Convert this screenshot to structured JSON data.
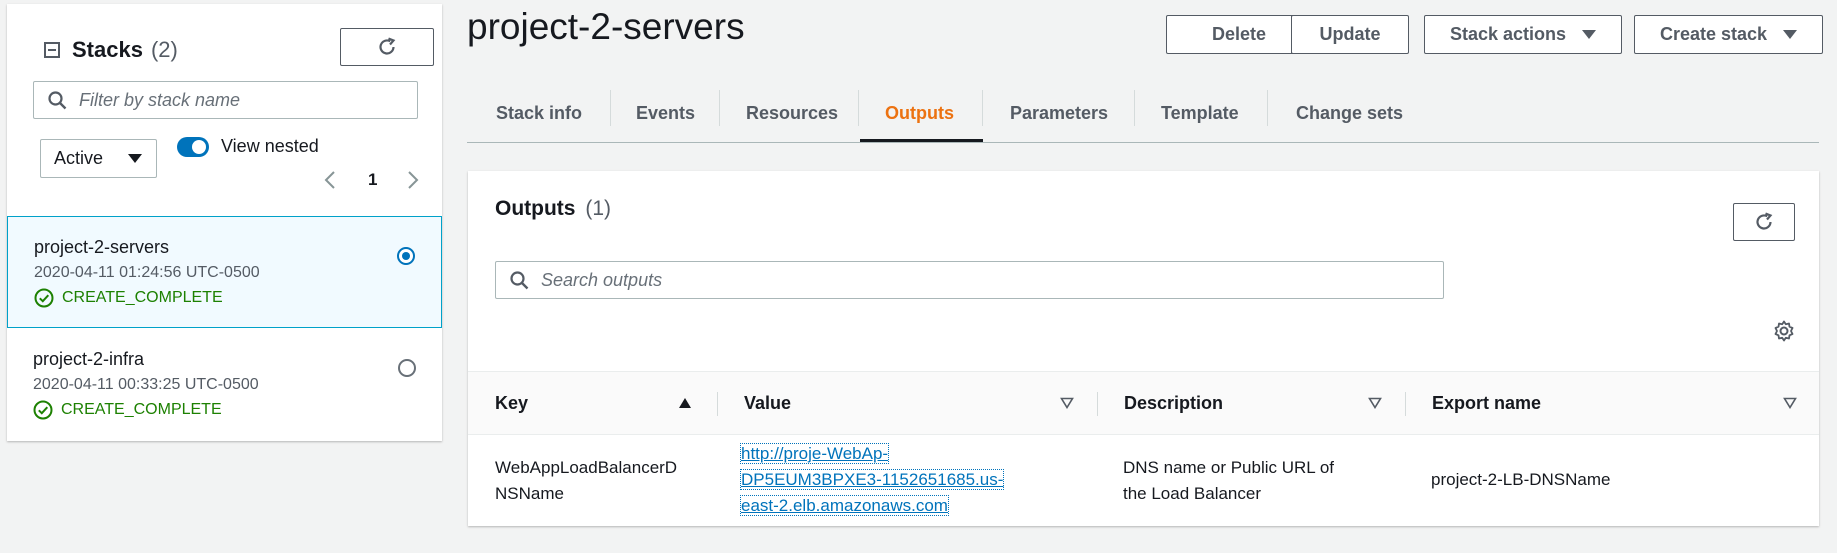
{
  "sidebar": {
    "title": "Stacks",
    "count": "(2)",
    "filter_placeholder": "Filter by stack name",
    "status_filter": "Active",
    "view_nested_label": "View nested",
    "page": "1",
    "stacks": [
      {
        "name": "project-2-servers",
        "date": "2020-04-11 01:24:56 UTC-0500",
        "status": "CREATE_COMPLETE"
      },
      {
        "name": "project-2-infra",
        "date": "2020-04-11 00:33:25 UTC-0500",
        "status": "CREATE_COMPLETE"
      }
    ]
  },
  "header": {
    "title": "project-2-servers",
    "buttons": {
      "delete": "Delete",
      "update": "Update",
      "stack_actions": "Stack actions",
      "create_stack": "Create stack"
    }
  },
  "tabs": [
    "Stack info",
    "Events",
    "Resources",
    "Outputs",
    "Parameters",
    "Template",
    "Change sets"
  ],
  "outputs": {
    "title": "Outputs",
    "count": "(1)",
    "search_placeholder": "Search outputs",
    "columns": [
      "Key",
      "Value",
      "Description",
      "Export name"
    ],
    "rows": [
      {
        "key_line1": "WebAppLoadBalancerD",
        "key_line2": "NSName",
        "value_line1": "http://proje-WebAp-",
        "value_line2": "DP5EUM3BPXE3-1152651685.us-",
        "value_line3": "east-2.elb.amazonaws.com",
        "description_line1": "DNS name or Public URL of",
        "description_line2": "the Load Balancer",
        "export_name": "project-2-LB-DNSName"
      }
    ]
  },
  "colors": {
    "accent_orange": "#ec7211",
    "link_blue": "#0073bb",
    "success_green": "#1d8102"
  }
}
